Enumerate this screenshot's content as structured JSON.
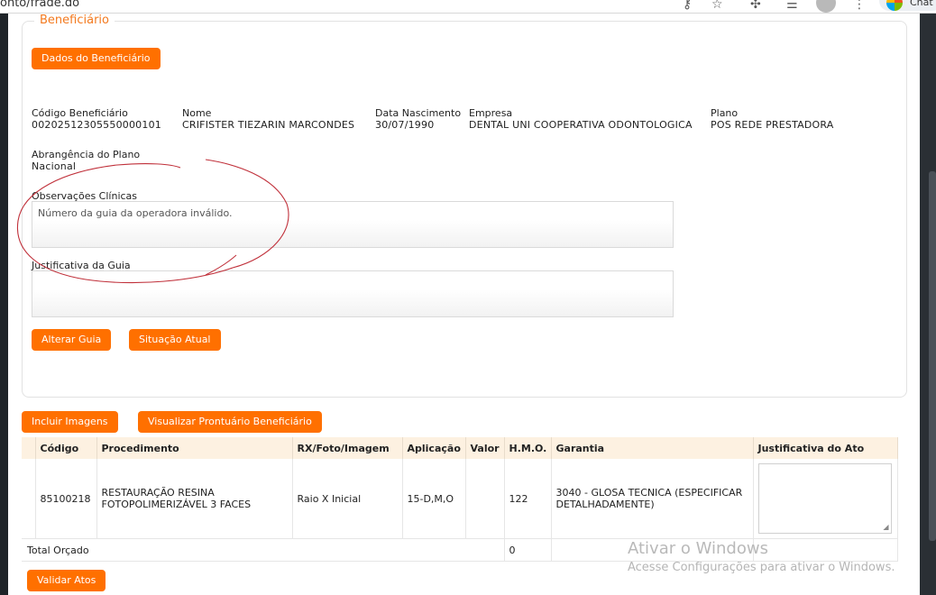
{
  "browser": {
    "url_fragment": "onto/frade.do",
    "chat_label": "Chat",
    "icons": [
      "key-icon",
      "star-icon",
      "extensions-icon",
      "reading-list-icon",
      "profile-avatar",
      "menu-dots-icon"
    ]
  },
  "beneficiario": {
    "legend": "Beneficiário",
    "dados_button": "Dados do Beneficiário",
    "fields": {
      "codigo_label": "Código Beneficiário",
      "codigo_value": "00202512305550000101",
      "nome_label": "Nome",
      "nome_value": "CRIFISTER TIEZARIN MARCONDES",
      "nascimento_label": "Data Nascimento",
      "nascimento_value": "30/07/1990",
      "empresa_label": "Empresa",
      "empresa_value": "DENTAL UNI COOPERATIVA ODONTOLOGICA",
      "plano_label": "Plano",
      "plano_value": "POS REDE PRESTADORA",
      "abrangencia_label": "Abrangência do Plano",
      "abrangencia_value": "Nacional"
    },
    "observacoes_label": "Observações Clínicas",
    "observacoes_value": "Número da guia da operadora inválido.",
    "justificativa_label": "Justificativa da Guia",
    "justificativa_value": "",
    "alterar_button": "Alterar Guia",
    "situacao_button": "Situação Atual"
  },
  "actions": {
    "incluir_button": "Incluir Imagens",
    "prontuario_button": "Visualizar Prontuário Beneficiário",
    "validar_button": "Validar Atos"
  },
  "table": {
    "headers": [
      "Código",
      "Procedimento",
      "RX/Foto/Imagem",
      "Aplicação",
      "Valor",
      "H.M.O.",
      "Garantia",
      "Justificativa do Ato"
    ],
    "rows": [
      {
        "codigo": "85100218",
        "procedimento": "RESTAURAÇÃO RESINA FOTOPOLIMERIZÁVEL 3 FACES",
        "rx": "Raio X Inicial",
        "aplicacao": "15-D,M,O",
        "valor": "",
        "hmo": "122",
        "garantia": "3040 - GLOSA TECNICA (ESPECIFICAR DETALHADAMENTE)",
        "justificativa": ""
      }
    ],
    "total_label": "Total Orçado",
    "total_hmo": "0"
  },
  "watermark": {
    "line1": "Ativar o Windows",
    "line2": "Acesse Configurações para ativar o Windows."
  },
  "colors": {
    "accent": "#ff7000",
    "legend": "#f37a1f",
    "header_bg": "#fdf1e1",
    "annotation": "#c0303a"
  }
}
